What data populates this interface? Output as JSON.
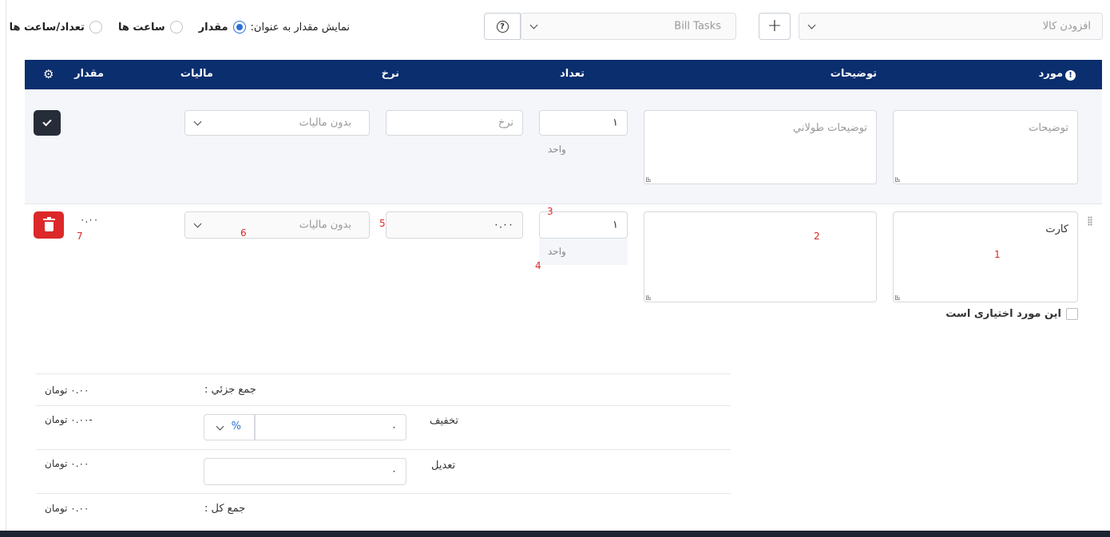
{
  "toolbar": {
    "add_item_placeholder": "افزودن کالا",
    "add_button": "+",
    "bill_tasks_placeholder": "Bill Tasks",
    "help_icon": "question-circle-icon",
    "display_label": "نمایش مقدار به عنوان:",
    "options": [
      "مقدار",
      "ساعت ها",
      "تعداد/ساعت ها"
    ],
    "selected_option": "مقدار"
  },
  "table": {
    "headers": {
      "item": "مورد",
      "description": "توضیحات",
      "quantity": "تعداد",
      "rate": "نرخ",
      "tax": "ماليات",
      "amount": "مقدار"
    },
    "icons": {
      "required": "exclamation-circle-icon",
      "settings": "gear-icon"
    }
  },
  "new_row": {
    "description_placeholder": "توضیحات",
    "long_description_placeholder": "توضيحات طولاني",
    "quantity_value": "١",
    "unit_label": "واحد",
    "rate_placeholder": "نرخ",
    "tax_placeholder": "بدون ماليات",
    "confirm_icon": "check-icon"
  },
  "item_row": {
    "description_value": "کارت",
    "long_description_value": "",
    "quantity_value": "١",
    "unit_label": "واحد",
    "rate_value": "٠.٠٠",
    "tax_placeholder": "بدون ماليات",
    "amount_value": "٠.٠٠",
    "delete_icon": "trash-icon",
    "drag_icon": "drag-handle-icon",
    "markers": [
      "1",
      "2",
      "3",
      "4",
      "5",
      "6",
      "7"
    ],
    "optional_label": "این مورد اختیاری است"
  },
  "totals": {
    "subtotal_label": "جمع جزئي :",
    "subtotal_value": "٠.٠٠ تومان",
    "discount_label": "تخفيف",
    "discount_input": "٠",
    "discount_type": "%",
    "discount_value": "-٠.٠٠ تومان",
    "adjustment_label": "تعديل",
    "adjustment_input": "٠",
    "adjustment_value": "٠.٠٠ تومان",
    "total_label": "جمع کل :",
    "total_value": "٠.٠٠ تومان"
  }
}
